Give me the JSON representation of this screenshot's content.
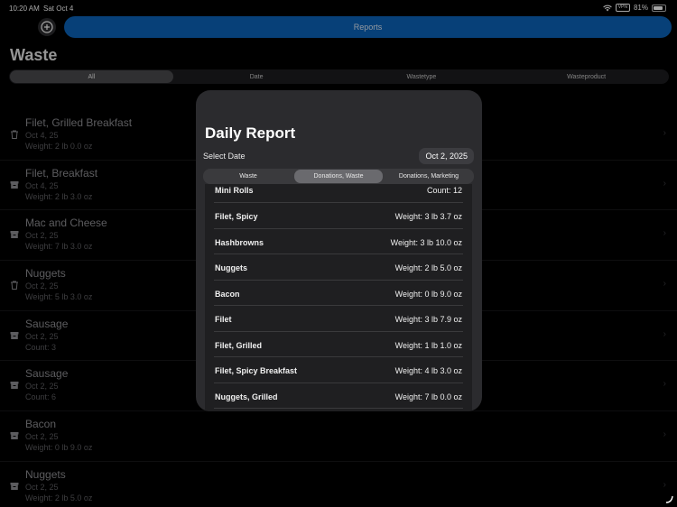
{
  "status_bar": {
    "time": "10:20 AM",
    "date": "Sat Oct 4",
    "vpn": "VPN",
    "battery": "81%"
  },
  "header": {
    "reports_label": "Reports",
    "page_title": "Waste"
  },
  "filter_segments": [
    {
      "label": "All",
      "active": true
    },
    {
      "label": "Date",
      "active": false
    },
    {
      "label": "Wastetype",
      "active": false
    },
    {
      "label": "Wasteproduct",
      "active": false
    }
  ],
  "waste_list": [
    {
      "icon": "trash-icon",
      "name": "Filet, Grilled Breakfast",
      "date": "Oct 4, 25",
      "detail": "Weight: 2 lb 0.0 oz"
    },
    {
      "icon": "box-icon",
      "name": "Filet, Breakfast",
      "date": "Oct 4, 25",
      "detail": "Weight: 2 lb 3.0 oz"
    },
    {
      "icon": "box-icon",
      "name": "Mac and Cheese",
      "date": "Oct 2, 25",
      "detail": "Weight: 7 lb 3.0 oz"
    },
    {
      "icon": "trash-icon",
      "name": "Nuggets",
      "date": "Oct 2, 25",
      "detail": "Weight: 5 lb 3.0 oz"
    },
    {
      "icon": "box-icon",
      "name": "Sausage",
      "date": "Oct 2, 25",
      "detail": "Count: 3"
    },
    {
      "icon": "box-icon",
      "name": "Sausage",
      "date": "Oct 2, 25",
      "detail": "Count: 6"
    },
    {
      "icon": "box-icon",
      "name": "Bacon",
      "date": "Oct 2, 25",
      "detail": "Weight: 0 lb 9.0 oz"
    },
    {
      "icon": "box-icon",
      "name": "Nuggets",
      "date": "Oct 2, 25",
      "detail": "Weight: 2 lb 5.0 oz"
    }
  ],
  "modal": {
    "title": "Daily Report",
    "select_date_label": "Select Date",
    "selected_date": "Oct 2, 2025",
    "tabs": [
      {
        "label": "Waste",
        "active": false
      },
      {
        "label": "Donations, Waste",
        "active": true
      },
      {
        "label": "Donations, Marketing",
        "active": false
      }
    ],
    "items": [
      {
        "name": "Mini Rolls",
        "value": "Count: 12"
      },
      {
        "name": "Filet, Spicy",
        "value": "Weight: 3 lb 3.7 oz"
      },
      {
        "name": "Hashbrowns",
        "value": "Weight: 3 lb 10.0 oz"
      },
      {
        "name": "Nuggets",
        "value": "Weight: 2 lb 5.0 oz"
      },
      {
        "name": "Bacon",
        "value": "Weight: 0 lb 9.0 oz"
      },
      {
        "name": "Filet",
        "value": "Weight: 3 lb 7.9 oz"
      },
      {
        "name": "Filet, Grilled",
        "value": "Weight: 1 lb 1.0 oz"
      },
      {
        "name": "Filet, Spicy Breakfast",
        "value": "Weight: 4 lb 3.0 oz"
      },
      {
        "name": "Nuggets, Grilled",
        "value": "Weight: 7 lb 0.0 oz"
      }
    ]
  },
  "colors": {
    "accent": "#0b63b8",
    "background": "#000000",
    "modal": "#2b2b2e"
  }
}
